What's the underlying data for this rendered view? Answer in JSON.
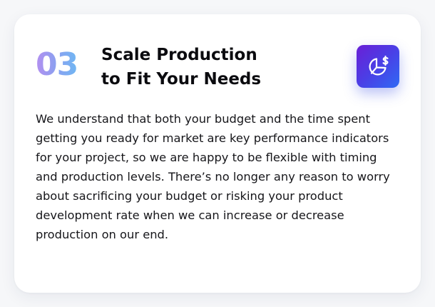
{
  "card": {
    "step_number": "03",
    "title_lines": [
      "Scale Production",
      "to Fit Your Needs"
    ],
    "icon": "pie-chart-dollar-icon",
    "accent_gradient": [
      "#6a1fd6",
      "#2f6af4"
    ],
    "number_gradient": [
      "#b48ff0",
      "#6fb7f3"
    ],
    "body_lines": [
      "We understand that both your budget and the time spent",
      "getting you ready for market are key performance indicators",
      "for your project, so we are happy to be flexible with timing",
      "and production levels. There’s no longer any reason to worry",
      "about sacrificing your budget or risking your product",
      "development rate when we can increase or decrease",
      "production on our end."
    ]
  }
}
